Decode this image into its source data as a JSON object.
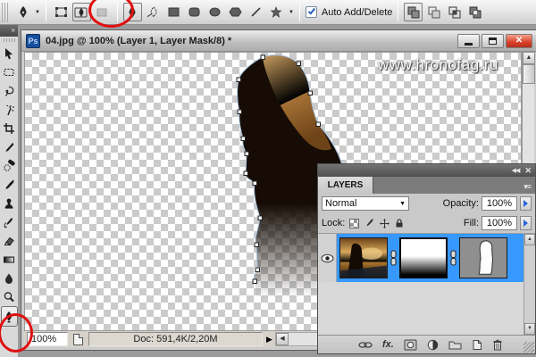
{
  "options_bar": {
    "auto_add_delete": {
      "label": "Auto Add/Delete",
      "checked": true
    },
    "modes": [
      "shape-layers",
      "paths",
      "fill-pixels"
    ],
    "shape_tools": [
      "pen",
      "freeform-pen",
      "rectangle",
      "rounded-rectangle",
      "ellipse",
      "polygon",
      "line",
      "custom-shape"
    ],
    "path_ops": [
      "add-to-path-area",
      "subtract-from-path-area",
      "intersect-path-areas",
      "exclude-overlapping-path-areas"
    ]
  },
  "toolbox": {
    "tools": [
      "move",
      "rectangular-marquee",
      "lasso",
      "magic-wand",
      "crop",
      "eyedropper",
      "spot-healing-brush",
      "brush",
      "clone-stamp",
      "history-brush",
      "eraser",
      "gradient",
      "blur",
      "dodge",
      "pen"
    ],
    "selected_tool": "pen"
  },
  "window": {
    "app_icon_text": "Ps",
    "title": "04.jpg @ 100% (Layer 1, Layer Mask/8) *",
    "watermark": "www.hronofag.ru",
    "status": {
      "zoom": "100%",
      "doc": "Doc: 591,4K/2,20M"
    }
  },
  "layers_panel": {
    "tab": "LAYERS",
    "blend_mode": "Normal",
    "opacity_label": "Opacity:",
    "opacity_value": "100%",
    "lock_label": "Lock:",
    "fill_label": "Fill:",
    "fill_value": "100%",
    "layer": {
      "thumbnails": [
        "image",
        "gradient-layer-mask",
        "vector-mask"
      ],
      "selected": true,
      "visible": true
    }
  },
  "icons": {
    "chevrons": "»",
    "panel_collapse": "◀◀",
    "panel_close": "✕",
    "panel_menu": "▾≡",
    "dropdown": "▼",
    "scroll_up": "▲",
    "scroll_down": "▼",
    "scroll_left": "◀",
    "flyout": "▶",
    "close": "✕",
    "fx": "fx."
  },
  "colors": {
    "selection_blue": "#3798ff",
    "annotation_red": "#e01010",
    "close_button_red": "#d9402a"
  }
}
